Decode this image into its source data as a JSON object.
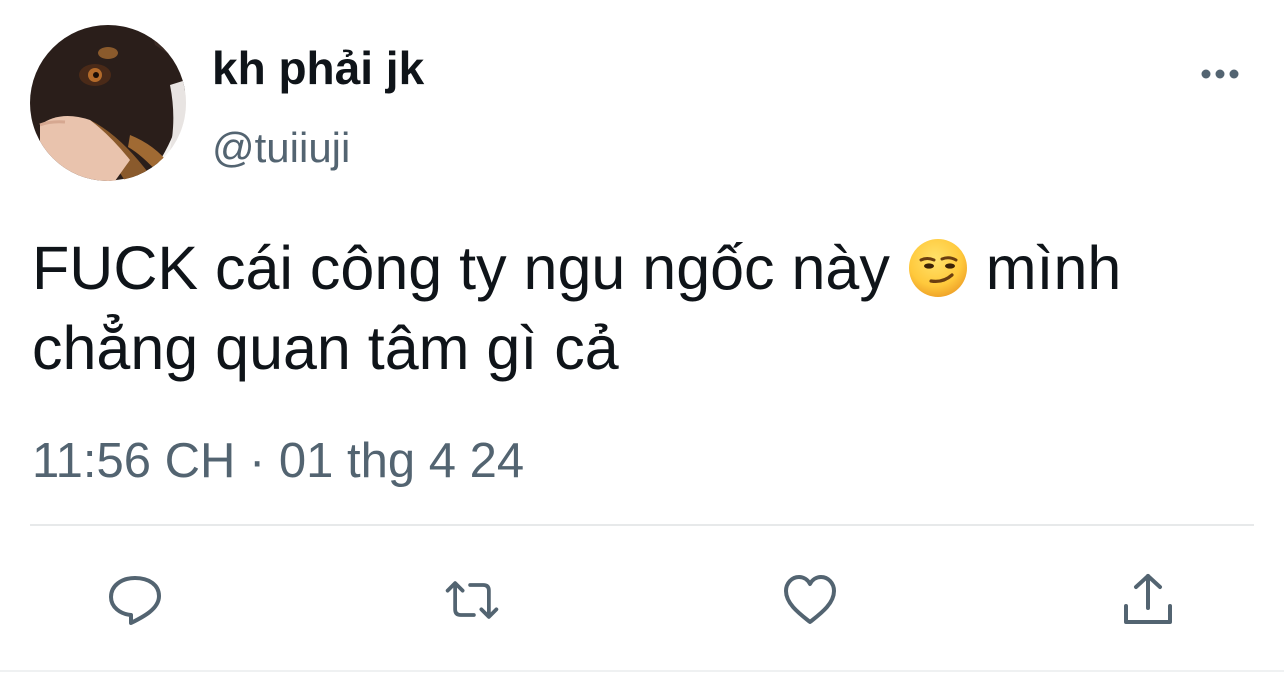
{
  "tweet": {
    "author": {
      "display_name": "kh phải jk",
      "handle": "@tuiiuji",
      "avatar": "doberman-dog-photo"
    },
    "text_parts": {
      "before_emoji": "FUCK cái công ty ngu ngốc này ",
      "emoji": "smirking-face-emoji",
      "after_emoji": " mình chẳng quan tâm gì cả"
    },
    "timestamp": "11:56 CH · 01 thg 4 24"
  },
  "actions": [
    {
      "name": "reply",
      "icon": "reply-icon"
    },
    {
      "name": "retweet",
      "icon": "retweet-icon"
    },
    {
      "name": "like",
      "icon": "heart-icon"
    },
    {
      "name": "share",
      "icon": "share-icon"
    }
  ],
  "colors": {
    "primary_text": "#0f1419",
    "secondary_text": "#536471",
    "divider": "#e7e9ea",
    "background": "#ffffff"
  }
}
